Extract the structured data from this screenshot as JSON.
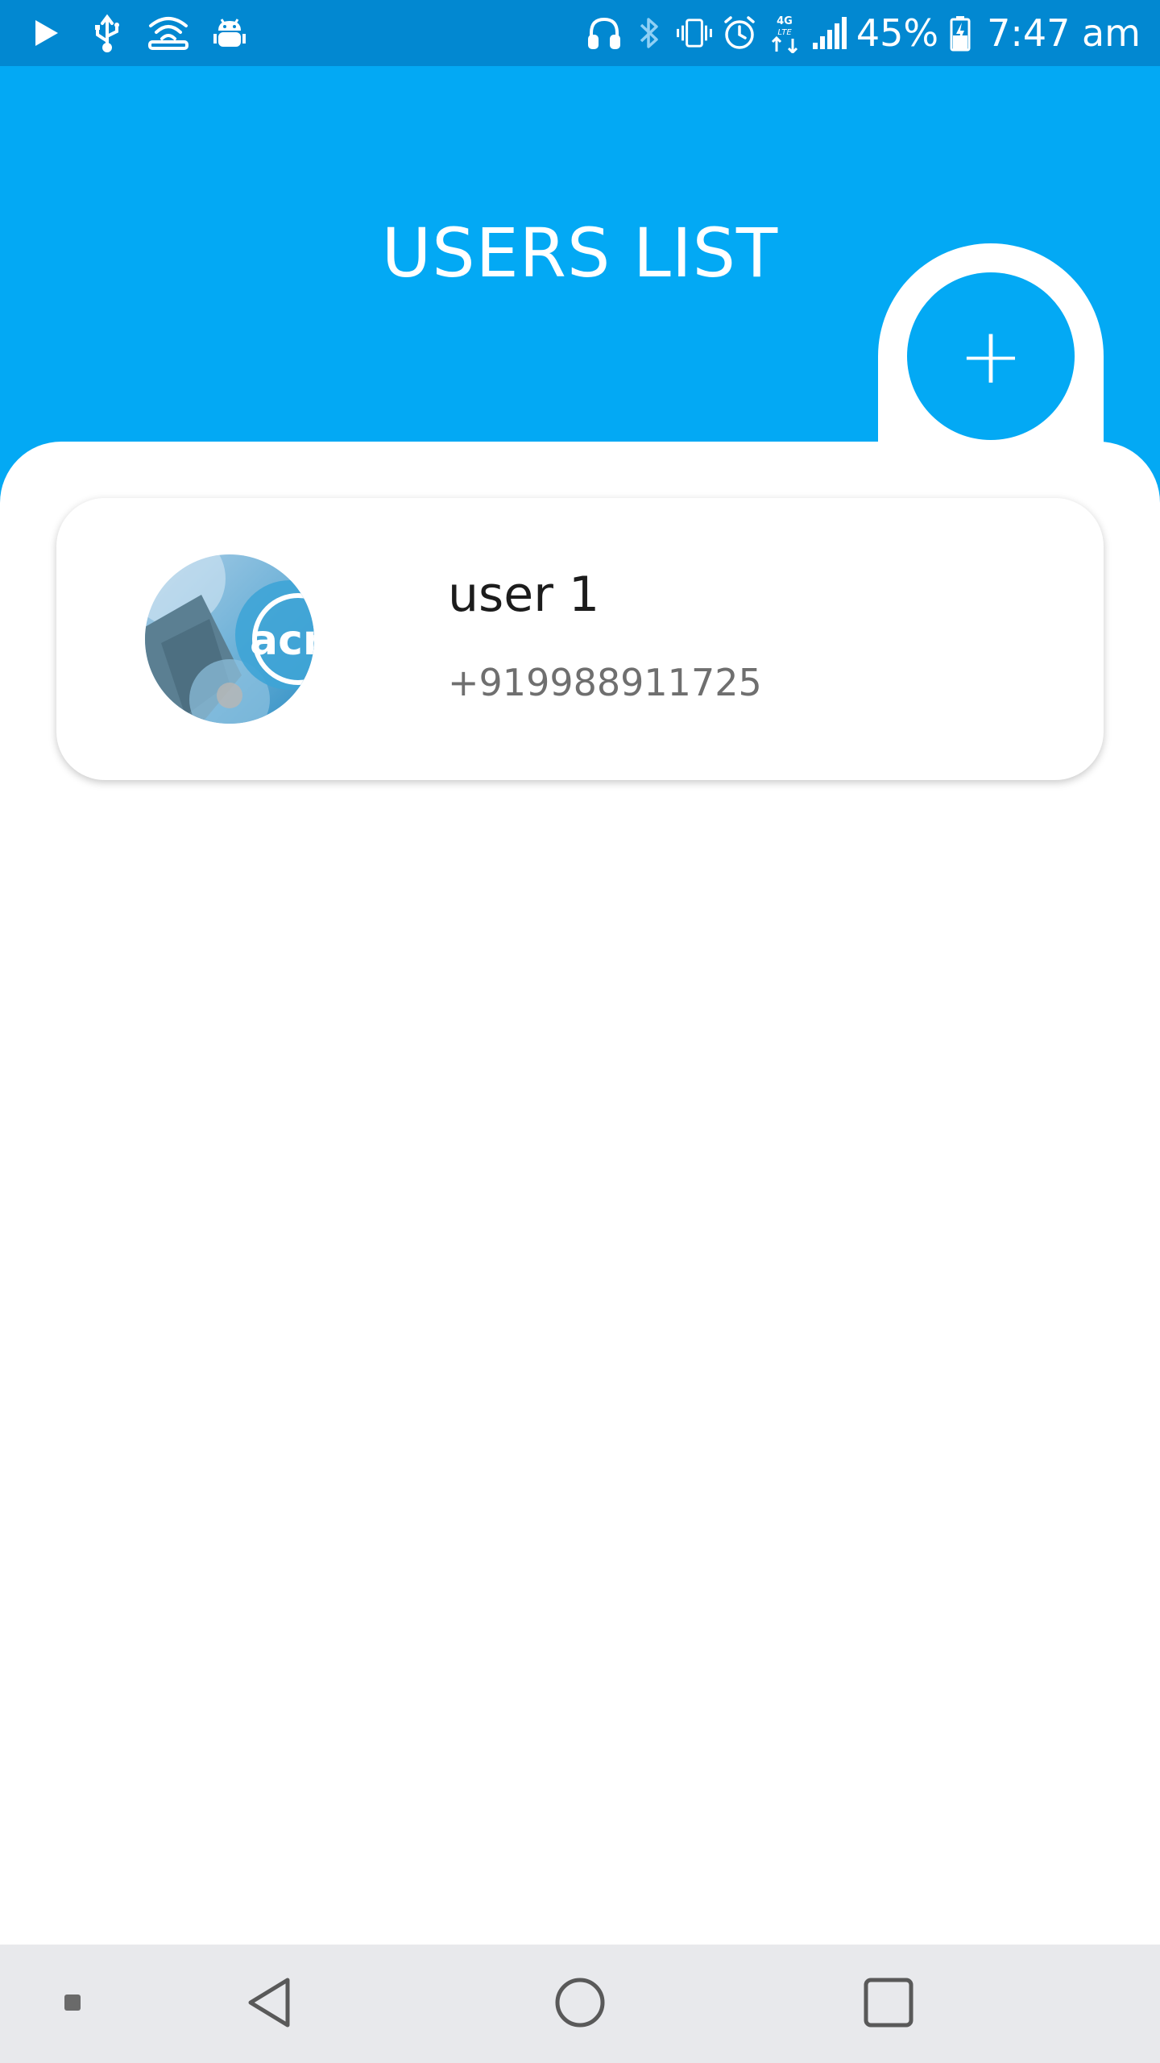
{
  "status_bar": {
    "battery_percent": "45%",
    "time": "7:47 am",
    "network_type": "4G",
    "left_icons": [
      "play-icon",
      "usb-icon",
      "wifi-hotspot-icon",
      "android-debug-icon"
    ],
    "right_icons": [
      "headphones-icon",
      "bluetooth-icon",
      "vibrate-icon",
      "alarm-icon",
      "lte-data-icon",
      "signal-icon",
      "battery-icon"
    ]
  },
  "header": {
    "title": "USERS LIST",
    "background_color": "#03a9f4"
  },
  "fab": {
    "label": "+",
    "icon": "add-icon",
    "color": "#03a9f4"
  },
  "users": [
    {
      "name": "user 1",
      "phone": "+919988911725",
      "avatar_text": "acr"
    }
  ],
  "nav_bar": {
    "buttons": [
      "square-dot-icon",
      "back-icon",
      "home-icon",
      "recents-icon"
    ]
  }
}
